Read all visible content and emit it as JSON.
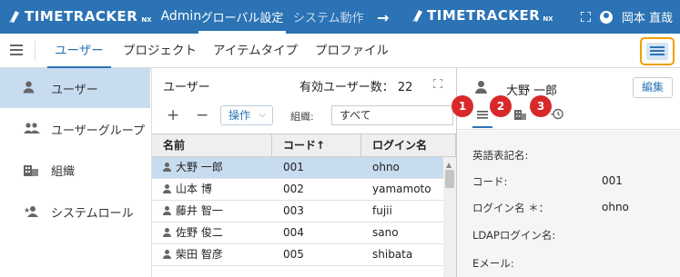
{
  "topbar": {
    "brand": "TIMETRACKER",
    "brand_suffix": "NX",
    "admin_label": "Admin",
    "nav_global": "グローバル設定",
    "nav_system": "システム動作",
    "brand2": "TIMETRACKER",
    "brand2_suffix": "NX",
    "user_name": "岡本 直哉"
  },
  "tabs": [
    "ユーザー",
    "プロジェクト",
    "アイテムタイプ",
    "プロファイル"
  ],
  "sidebar": {
    "items": [
      {
        "label": "ユーザー",
        "icon": "person-icon"
      },
      {
        "label": "ユーザーグループ",
        "icon": "people-icon"
      },
      {
        "label": "組織",
        "icon": "building-icon"
      },
      {
        "label": "システムロール",
        "icon": "person-star-icon"
      }
    ]
  },
  "users_panel": {
    "title": "ユーザー",
    "active_count_label": "有効ユーザー数：",
    "active_count": "22",
    "ops_label": "操作",
    "org_label": "組織:",
    "org_value": "すべて",
    "columns": [
      "名前",
      "コード↑",
      "ログイン名"
    ],
    "rows": [
      {
        "name": "大野 一郎",
        "code": "001",
        "login": "ohno"
      },
      {
        "name": "山本 博",
        "code": "002",
        "login": "yamamoto"
      },
      {
        "name": "藤井 智一",
        "code": "003",
        "login": "fujii"
      },
      {
        "name": "佐野 俊二",
        "code": "004",
        "login": "sano"
      },
      {
        "name": "柴田 智彦",
        "code": "005",
        "login": "shibata"
      }
    ]
  },
  "detail": {
    "name": "大野 一郎",
    "edit_label": "編集",
    "badges": [
      "1",
      "2",
      "3"
    ],
    "fields": [
      {
        "label": "英語表記名:",
        "value": ""
      },
      {
        "label": "コード:",
        "value": "001"
      },
      {
        "label": "ログイン名 ＊：",
        "value": "ohno"
      },
      {
        "label": "LDAPログイン名:",
        "value": ""
      },
      {
        "label": "Eメール:",
        "value": ""
      }
    ]
  },
  "colors": {
    "primary": "#2b73b5",
    "selected_row": "#c8dcf0",
    "highlight_border": "#f0a000",
    "badge": "#d9282a"
  }
}
